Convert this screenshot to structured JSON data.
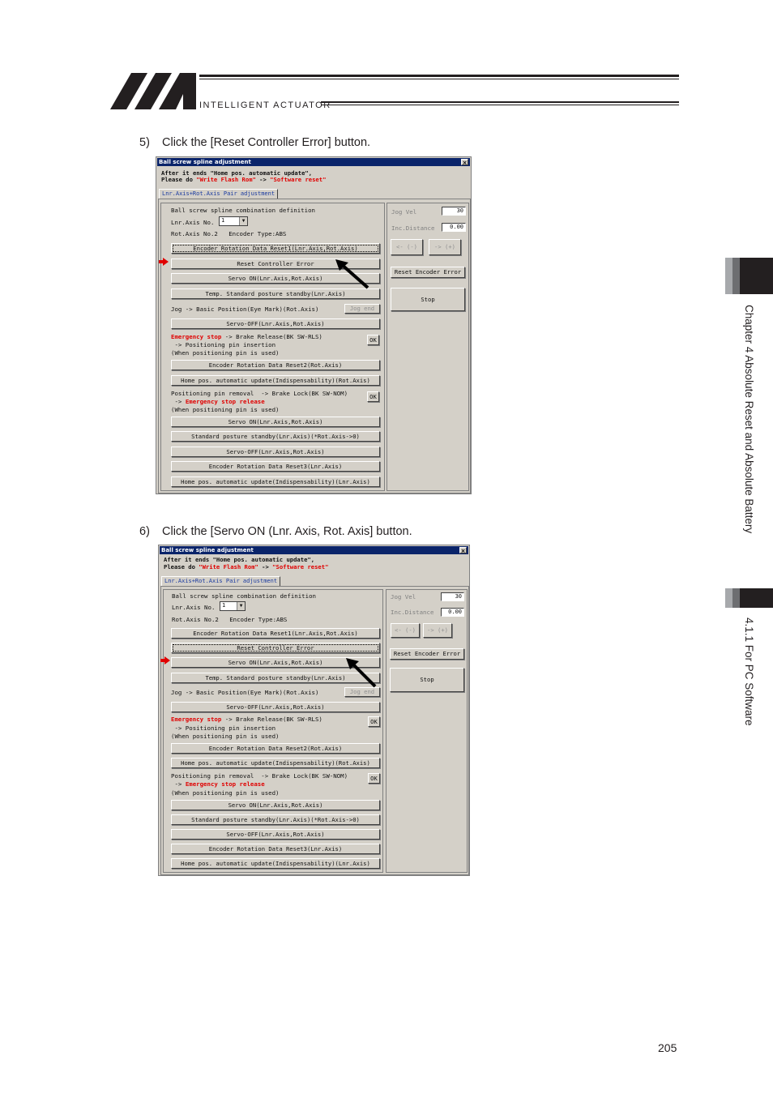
{
  "header": {
    "logo_subtitle": "INTELLIGENT ACTUATOR"
  },
  "steps": [
    {
      "number": "5)",
      "text": "Click the [Reset Controller Error] button."
    },
    {
      "number": "6)",
      "text": "Click the [Servo ON (Lnr. Axis, Rot. Axis] button."
    }
  ],
  "window": {
    "title": "Ball screw spline adjustment",
    "close": "×",
    "msg_line1": "After it ends \"Home pos. automatic update\",",
    "msg_line2_prefix": "Please do ",
    "msg_line2_red1": "\"Write Flash Rom\"",
    "msg_line2_arrow": " -> ",
    "msg_line2_red2": "\"Software reset\"",
    "tab_label": "Lnr.Axis+Rot.Axis Pair adjustment",
    "definition_title": "Ball screw spline combination definition",
    "lnr_axis_label": "Lnr.Axis No.",
    "lnr_axis_value": "1",
    "rot_axis_label": "Rot.Axis No.2   Encoder Type:ABS",
    "btn_encoder_reset1": "Encoder Rotation Data Reset1(Lnr.Axis,Rot.Axis)",
    "btn_reset_ctrl_error": "Reset Controller Error",
    "btn_servo_on": "Servo ON(Lnr.Axis,Rot.Axis)",
    "btn_temp_standby": "Temp. Standard posture standby(Lnr.Axis)",
    "jog_label": "Jog -> Basic Position(Eye Mark)(Rot.Axis)",
    "btn_jog_end": "Jog end",
    "btn_servo_off": "Servo-OFF(Lnr.Axis,Rot.Axis)",
    "emg_red": "Emergency stop",
    "emg_rest": " -> Brake Release(BK SW-RLS)",
    "emg_line2": " -> Positioning pin insertion",
    "emg_line3": "(When positioning pin is used)",
    "btn_ok": "OK",
    "btn_encoder_reset2": "Encoder Rotation Data Reset2(Rot.Axis)",
    "btn_home_rot": "Home pos. automatic update(Indispensability)(Rot.Axis)",
    "pin_line1": "Positioning pin removal  -> Brake Lock(BK SW-NOM)",
    "pin_line2_prefix": " -> ",
    "pin_line2_red": "Emergency stop release",
    "pin_line3": "(When positioning pin is used)",
    "btn_servo_on2": "Servo ON(Lnr.Axis,Rot.Axis)",
    "btn_std_standby": "Standard posture standby(Lnr.Axis)(*Rot.Axis->0)",
    "btn_servo_off2": "Servo-OFF(Lnr.Axis,Rot.Axis)",
    "btn_encoder_reset3": "Encoder Rotation Data Reset3(Lnr.Axis)",
    "btn_home_lnr": "Home pos. automatic update(Indispensability)(Lnr.Axis)",
    "jog_vel_label": "Jog Vel",
    "jog_vel_value": "30",
    "inc_dist_label": "Inc.Distance",
    "inc_dist_value": "0.00",
    "btn_jog_minus": "<- (-)",
    "btn_jog_plus": "-> (+)",
    "btn_reset_encoder_error": "Reset Encoder Error",
    "btn_stop": "Stop"
  },
  "sidebar": {
    "chapter": "Chapter 4 Absolute Reset and Absolute Battery",
    "section": "4.1.1 For PC Software"
  },
  "page_number": "205",
  "colors": {
    "titlebar": "#0a246a",
    "window_bg": "#d4d0c8",
    "highlight_red": "#e00000",
    "tab_text": "#1a3aa0",
    "sidebar_dark": "#231f20",
    "sidebar_mid": "#6d6e71",
    "sidebar_light": "#a7a9ac"
  }
}
